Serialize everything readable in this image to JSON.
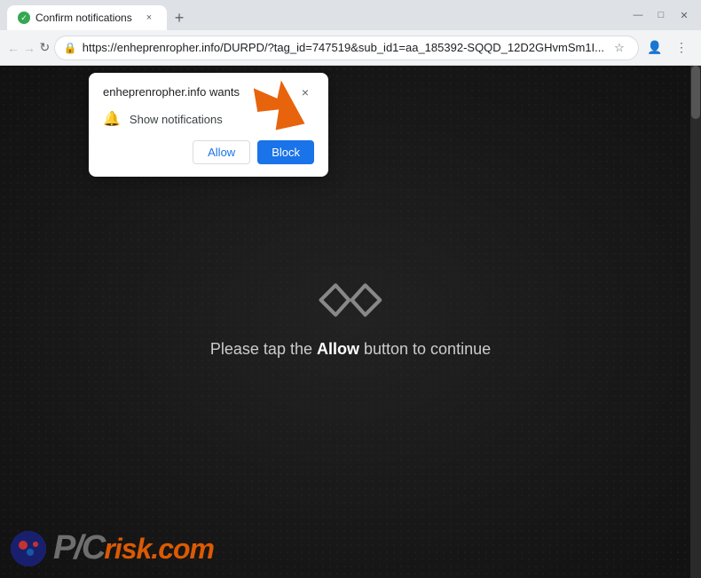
{
  "browser": {
    "title": "Confirm notifications",
    "tab_close": "×",
    "new_tab": "+",
    "window_controls": {
      "minimize": "—",
      "maximize": "□",
      "close": "✕"
    }
  },
  "nav": {
    "back": "←",
    "forward": "→",
    "refresh": "↻",
    "url": "https://enheprenropher.info/DURPD/?tag_id=747519&sub_id1=aa_185392-SQQD_12D2GHvmSm1I...",
    "star": "☆",
    "profile": "👤",
    "menu": "⋮"
  },
  "popup": {
    "title": "enheprenropher.info wants",
    "close": "×",
    "permission_label": "Show notifications",
    "allow_label": "Allow",
    "block_label": "Block"
  },
  "webpage": {
    "body_text_pre": "Please tap the ",
    "body_text_bold": "Allow",
    "body_text_post": " button to continue"
  },
  "pcrisk": {
    "text_white": "P",
    "text_slash": "/",
    "text_c": "C",
    "brand": "risk.com"
  },
  "colors": {
    "accent_blue": "#1a73e8",
    "orange": "#ff6600",
    "bg_dark": "#1a1a1a",
    "text_light": "#cccccc"
  }
}
